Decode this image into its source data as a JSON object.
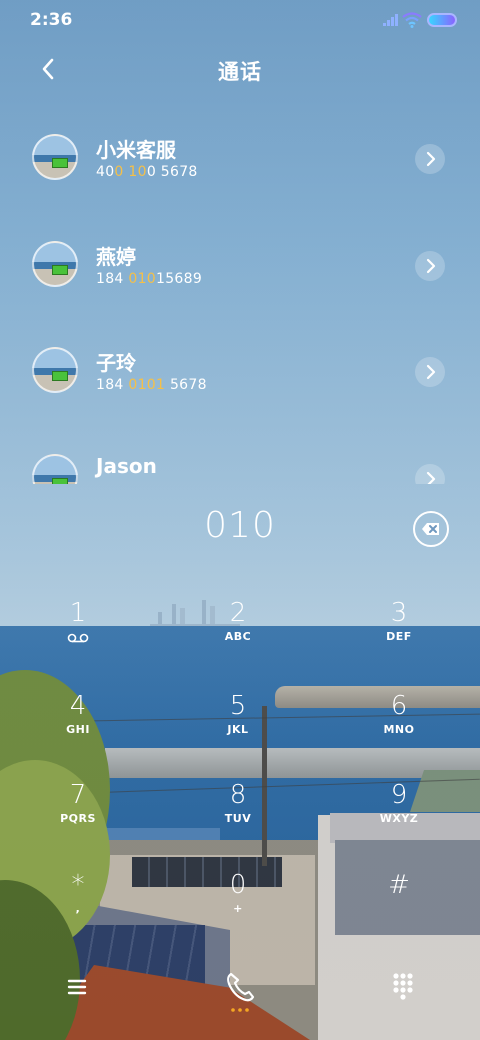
{
  "status_bar": {
    "time": "2:36"
  },
  "header": {
    "title": "通话"
  },
  "contacts": [
    {
      "name": "小米客服",
      "number_parts": [
        "40",
        "0",
        " ",
        "10",
        "0 5678"
      ]
    },
    {
      "name": "燕婷",
      "number_parts": [
        "184 ",
        "010",
        "",
        "",
        "15689"
      ]
    },
    {
      "name": "子玲",
      "number_parts": [
        "184 ",
        "010",
        "",
        "1",
        " 5678"
      ]
    },
    {
      "name": "Jason",
      "number_parts": [
        "",
        "",
        "",
        "",
        ""
      ]
    }
  ],
  "dialer": {
    "typed_number": "010"
  },
  "keypad": [
    {
      "digit": "1",
      "letters": ""
    },
    {
      "digit": "2",
      "letters": "ABC"
    },
    {
      "digit": "3",
      "letters": "DEF"
    },
    {
      "digit": "4",
      "letters": "GHI"
    },
    {
      "digit": "5",
      "letters": "JKL"
    },
    {
      "digit": "6",
      "letters": "MNO"
    },
    {
      "digit": "7",
      "letters": "PQRS"
    },
    {
      "digit": "8",
      "letters": "TUV"
    },
    {
      "digit": "9",
      "letters": "WXYZ"
    },
    {
      "digit": "*",
      "letters": ","
    },
    {
      "digit": "0",
      "letters": "+"
    },
    {
      "digit": "#",
      "letters": ""
    }
  ],
  "icons": {
    "back": "chevron-left-icon",
    "contact_arrow": "chevron-right-icon",
    "delete": "backspace-icon",
    "voicemail": "voicemail-icon",
    "menu": "menu-icon",
    "call": "phone-icon",
    "keypad": "dialpad-icon"
  },
  "colors": {
    "highlight": "#f5c048",
    "battery_start": "#39d6ff",
    "battery_end": "#8a64ff"
  }
}
